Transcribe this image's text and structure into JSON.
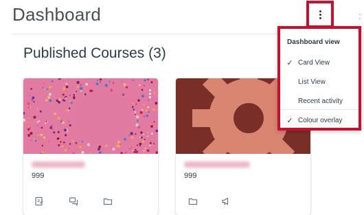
{
  "header": {
    "title": "Dashboard",
    "options_icon": "kebab-vertical-icon",
    "accent_color": "#c8102e"
  },
  "section": {
    "title": "Published Courses (3)"
  },
  "cards": [
    {
      "term": "999",
      "hero_color": "#e07aa0",
      "hero_pattern": "dotted-circle",
      "actions": [
        "assignments-icon",
        "discussions-icon",
        "files-icon"
      ]
    },
    {
      "term": "999",
      "hero_color": "#7a2e28",
      "hero_pattern": "gear",
      "actions": [
        "files-icon",
        "announcements-icon"
      ]
    }
  ],
  "menu": {
    "header": "Dashboard view",
    "items": [
      {
        "label": "Card View",
        "checked": true
      },
      {
        "label": "List View",
        "checked": false
      },
      {
        "label": "Recent activity",
        "checked": false
      },
      {
        "label": "Colour overlay",
        "checked": true
      }
    ]
  }
}
